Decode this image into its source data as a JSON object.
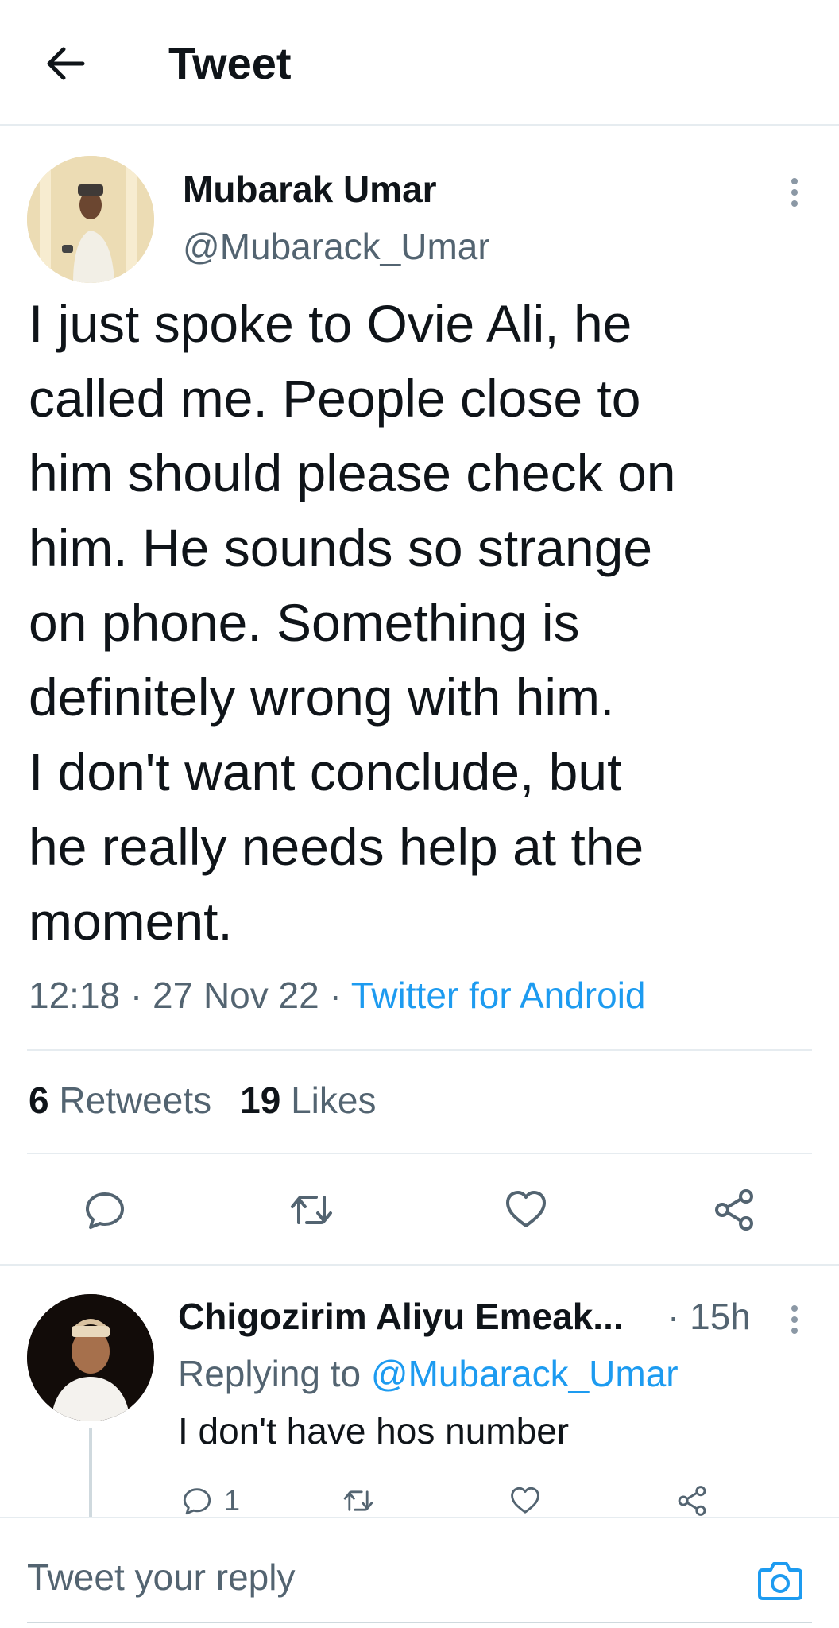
{
  "header": {
    "title": "Tweet",
    "back_icon": "arrow-left-icon"
  },
  "tweet": {
    "author_name": "Mubarak Umar",
    "author_handle": "@Mubarack_Umar",
    "text": "I just spoke to Ovie Ali, he\ncalled me. People close to\nhim should please check on\nhim. He sounds so strange\non phone. Something is\ndefinitely wrong with him.\nI don't want conclude, but\nhe really needs help at the\nmoment.",
    "time": "12:18",
    "date": "27 Nov 22",
    "separator": "·",
    "source": "Twitter for Android",
    "retweets_count": "6",
    "retweets_label": "Retweets",
    "likes_count": "19",
    "likes_label": "Likes",
    "colors": {
      "text": "#0f1419",
      "secondary": "#536471",
      "link": "#1d9bf0",
      "divider": "#e6ecf0"
    }
  },
  "reply": {
    "author_name": "Chigozirim Aliyu Emeak...",
    "time": "· 15h",
    "replying_label": "Replying to",
    "replying_to": "@Mubarack_Umar",
    "text": "I don't have hos number",
    "reply_count": "1"
  },
  "composer": {
    "placeholder": "Tweet your reply",
    "camera_icon": "camera-icon"
  }
}
